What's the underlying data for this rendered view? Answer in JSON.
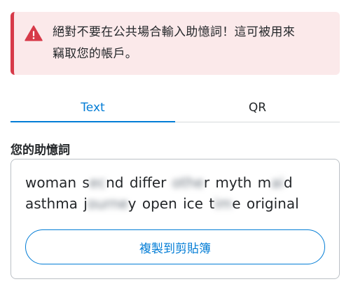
{
  "alert": {
    "icon": "warning-icon",
    "color": "#d73a49",
    "background": "#fbe9ea",
    "line1": "絕對不要在公共場合輸入助憶詞！這可被用來",
    "line2": "竊取您的帳戶。"
  },
  "tabs": [
    {
      "label": "Text",
      "active": true
    },
    {
      "label": "QR",
      "active": false
    }
  ],
  "accent_color": "#037dd6",
  "secret_phrase": {
    "label": "您的助憶詞",
    "words": [
      "woman",
      "s",
      "nd",
      "differ",
      "",
      "r",
      "myth",
      "m",
      "d",
      "asthma",
      "j",
      "y",
      "open",
      "ice",
      "t",
      "e",
      "original"
    ],
    "copy_label": "複製到剪貼簿"
  }
}
